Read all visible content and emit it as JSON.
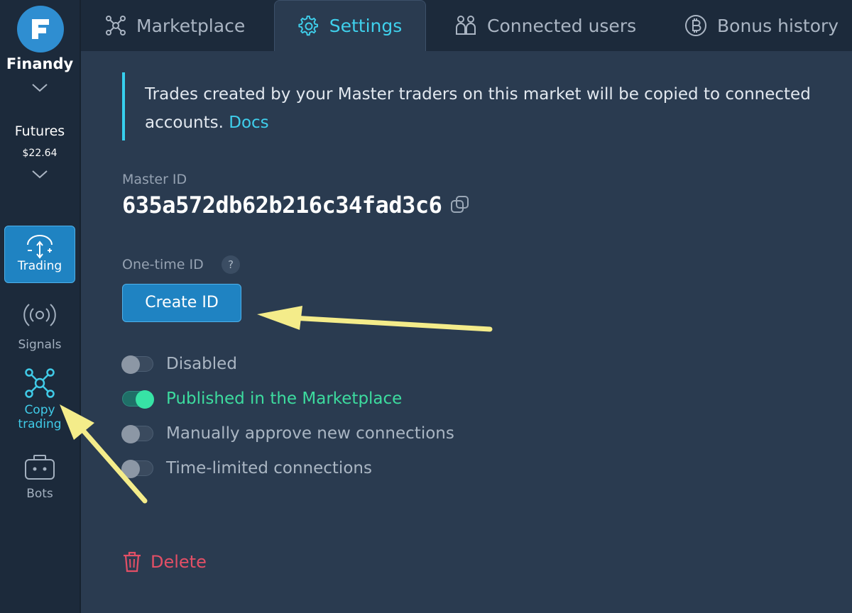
{
  "sidebar": {
    "brand": "Finandy",
    "account": {
      "name": "Futures",
      "balance": "$22.64"
    },
    "items": [
      {
        "label": "Trading",
        "active": true
      },
      {
        "label": "Signals"
      },
      {
        "label_line1": "Copy",
        "label_line2": "trading"
      },
      {
        "label": "Bots"
      }
    ]
  },
  "tabs": [
    {
      "label": "Marketplace",
      "icon": "network-icon"
    },
    {
      "label": "Settings",
      "icon": "gear-icon",
      "active": true
    },
    {
      "label": "Connected users",
      "icon": "users-icon"
    },
    {
      "label": "Bonus history",
      "icon": "bitcoin-icon"
    }
  ],
  "notice": {
    "text": "Trades created by your Master traders on this market will be copied to connected accounts.",
    "link": "Docs"
  },
  "master": {
    "label": "Master ID",
    "id": "635a572db62b216c34fad3c6"
  },
  "one_time": {
    "label": "One-time ID",
    "help": "?",
    "button": "Create ID"
  },
  "toggles": [
    {
      "label": "Disabled",
      "on": false
    },
    {
      "label": "Published in the Marketplace",
      "on": true
    },
    {
      "label": "Manually approve new connections",
      "on": false
    },
    {
      "label": "Time-limited connections",
      "on": false
    }
  ],
  "delete_label": "Delete",
  "colors": {
    "accent": "#3fd0ec",
    "button": "#1f83c2",
    "toggle_on": "#37e3a5",
    "danger": "#e34f66",
    "annotation_arrow": "#f4ec8a"
  }
}
